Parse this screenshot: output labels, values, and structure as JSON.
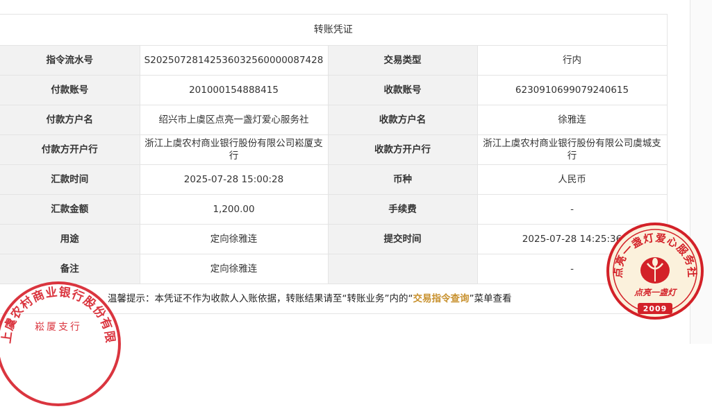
{
  "voucher": {
    "title": "转账凭证",
    "rows": [
      {
        "l1": "指令流水号",
        "v1": "S20250728142536032560000087428",
        "l2": "交易类型",
        "v2": "行内"
      },
      {
        "l1": "付款账号",
        "v1": "201000154888415",
        "l2": "收款账号",
        "v2": "6230910699079240615"
      },
      {
        "l1": "付款方户名",
        "v1": "绍兴市上虞区点亮一盏灯爱心服务社",
        "l2": "收款方户名",
        "v2": "徐雅连"
      },
      {
        "l1": "付款方开户行",
        "v1": "浙江上虞农村商业银行股份有限公司崧厦支行",
        "l2": "收款方开户行",
        "v2": "浙江上虞农村商业银行股份有限公司虞城支行"
      },
      {
        "l1": "汇款时间",
        "v1": "2025-07-28 15:00:28",
        "l2": "币种",
        "v2": "人民币"
      },
      {
        "l1": "汇款金额",
        "v1": "1,200.00",
        "l2": "手续费",
        "v2": "-"
      },
      {
        "l1": "用途",
        "v1": "定向徐雅连",
        "l2": "提交时间",
        "v2": "2025-07-28 14:25:36"
      },
      {
        "l1": "备注",
        "v1": "定向徐雅连",
        "l2": "",
        "v2": "-"
      }
    ],
    "tip": {
      "prefix": "温馨提示：本凭证不作为收款人入账依据，转账结果请至“转账业务”内的“",
      "highlight": "交易指令查询",
      "suffix": "”菜单查看"
    }
  },
  "seals": {
    "bank_seal": {
      "text": "浙江上虞农村商业银行股份有限公司",
      "branch": "崧厦支行",
      "color": "#d61f2a"
    },
    "org_seal": {
      "text": "点亮一盏灯爱心服务社",
      "inner_text": "点亮一盏灯",
      "year": "2009",
      "color": "#d32128"
    }
  },
  "colors": {
    "label_bg": "#f2f2f2",
    "border": "#e4e4e4",
    "highlight": "#c8912e"
  }
}
